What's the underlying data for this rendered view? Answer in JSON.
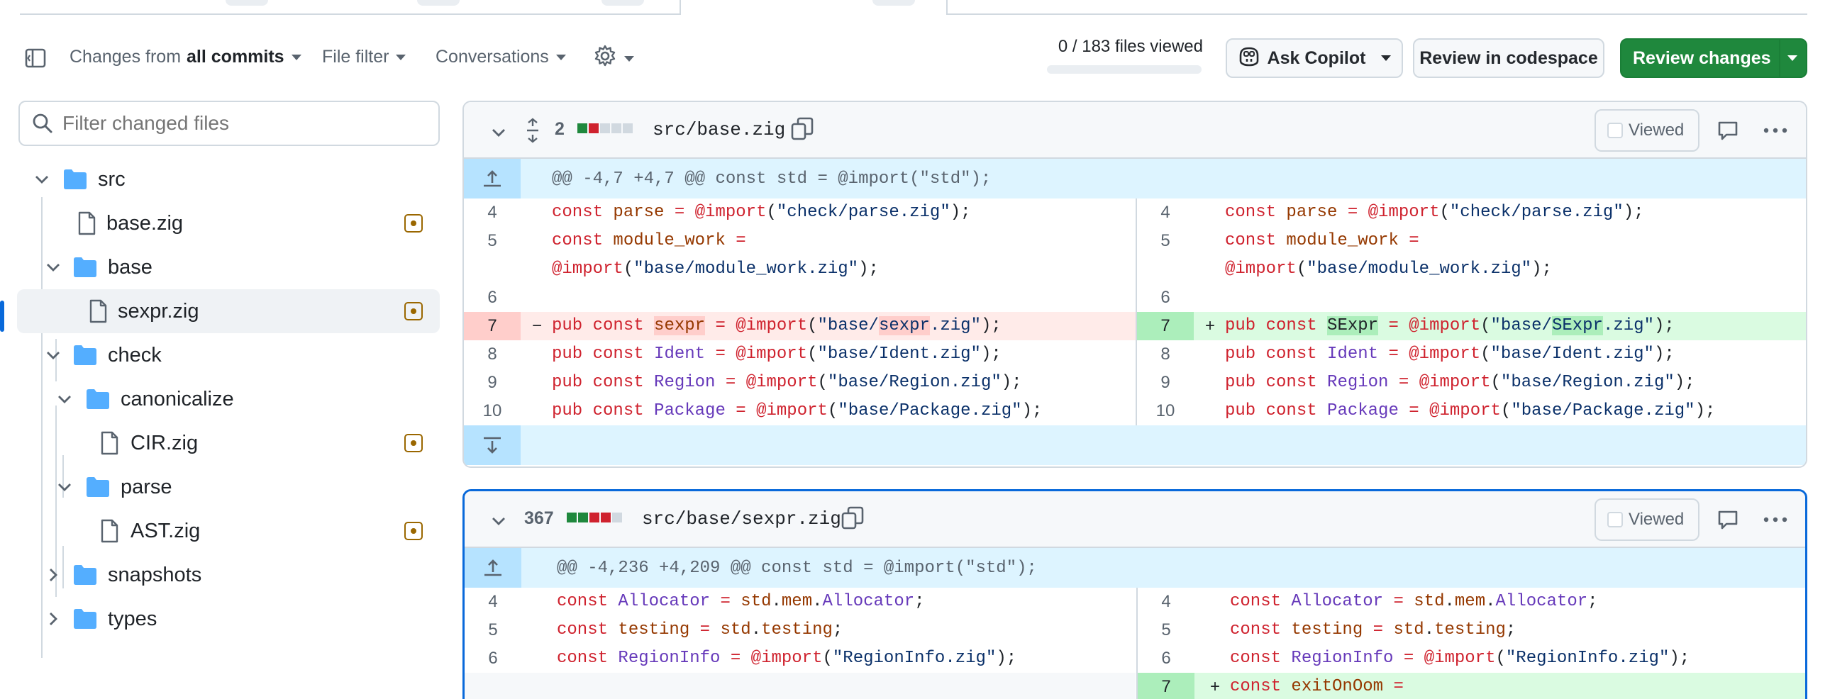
{
  "toolbar": {
    "changes_prefix": "Changes from",
    "changes_value": "all commits",
    "file_filter": "File filter",
    "conversations": "Conversations",
    "files_viewed": "0 / 183 files viewed",
    "files_viewed_progress": 0,
    "ask_copilot": "Ask Copilot",
    "review_codespace": "Review in codespace",
    "review_changes": "Review changes"
  },
  "sidebar": {
    "filter_placeholder": "Filter changed files",
    "tree": [
      {
        "label": "src",
        "type": "folder",
        "expanded": true
      },
      {
        "label": "base.zig",
        "type": "file",
        "status": "modified"
      },
      {
        "label": "base",
        "type": "folder",
        "expanded": true
      },
      {
        "label": "sexpr.zig",
        "type": "file",
        "status": "modified",
        "selected": true
      },
      {
        "label": "check",
        "type": "folder",
        "expanded": true
      },
      {
        "label": "canonicalize",
        "type": "folder",
        "expanded": true
      },
      {
        "label": "CIR.zig",
        "type": "file",
        "status": "modified"
      },
      {
        "label": "parse",
        "type": "folder",
        "expanded": true
      },
      {
        "label": "AST.zig",
        "type": "file",
        "status": "modified"
      },
      {
        "label": "snapshots",
        "type": "folder",
        "expanded": false
      },
      {
        "label": "types",
        "type": "folder",
        "expanded": false
      }
    ]
  },
  "diffs": [
    {
      "changes": "2",
      "filename": "src/base.zig",
      "viewed_label": "Viewed",
      "hunk": "@@ -4,7 +4,7 @@ const std = @import(\"std\");",
      "lines": [
        {
          "left_num": "4",
          "right_num": "4"
        },
        {
          "left_num": "5",
          "right_num": "5"
        },
        {
          "left_num": "",
          "right_num": ""
        },
        {
          "left_num": "6",
          "right_num": "6"
        },
        {
          "left_num": "7",
          "right_num": "7",
          "left_sign": "−",
          "right_sign": "+"
        },
        {
          "left_num": "8",
          "right_num": "8"
        },
        {
          "left_num": "9",
          "right_num": "9"
        },
        {
          "left_num": "10",
          "right_num": "10"
        }
      ]
    },
    {
      "changes": "367",
      "filename": "src/base/sexpr.zig",
      "viewed_label": "Viewed",
      "hunk": "@@ -4,236 +4,209 @@ const std = @import(\"std\");",
      "lines": [
        {
          "left_num": "4",
          "right_num": "4"
        },
        {
          "left_num": "5",
          "right_num": "5"
        },
        {
          "left_num": "6",
          "right_num": "6"
        },
        {
          "left_num": "",
          "right_num": "7",
          "right_sign": "+"
        }
      ]
    }
  ],
  "code": {
    "d1_l4": [
      "const",
      "parse",
      "=",
      "@import",
      "(",
      "\"check/parse.zig\"",
      ");"
    ],
    "d1_l5a": [
      "const",
      "module_work",
      "="
    ],
    "d1_l5b": [
      "@import",
      "(",
      "\"base/module_work.zig\"",
      ");"
    ],
    "d1_del": [
      "pub",
      "const",
      "sexpr",
      "=",
      "@import",
      "(",
      "\"base/",
      "sexpr",
      ".zig\"",
      ");"
    ],
    "d1_add": [
      "pub",
      "const",
      "SExpr",
      "=",
      "@import",
      "(",
      "\"base/",
      "SExpr",
      ".zig\"",
      ");"
    ],
    "d1_l8": [
      "pub",
      "const",
      "Ident",
      "=",
      "@import",
      "(",
      "\"base/Ident.zig\"",
      ");"
    ],
    "d1_l9": [
      "pub",
      "const",
      "Region",
      "=",
      "@import",
      "(",
      "\"base/Region.zig\"",
      ");"
    ],
    "d1_l10": [
      "pub",
      "const",
      "Package",
      "=",
      "@import",
      "(",
      "\"base/Package.zig\"",
      ");"
    ],
    "d2_l4": [
      "const",
      "Allocator",
      "=",
      "std",
      ".",
      "mem",
      ".",
      "Allocator",
      ";"
    ],
    "d2_l5": [
      "const",
      "testing",
      "=",
      "std",
      ".",
      "testing",
      ";"
    ],
    "d2_l6": [
      "const",
      "RegionInfo",
      "=",
      "@import",
      "(",
      "\"RegionInfo.zig\"",
      ");"
    ],
    "d2_l7": [
      "const",
      "exitOnOom",
      "="
    ]
  },
  "colors": {
    "accent_blue": "#0969da",
    "green_button": "#1f883d",
    "deletion_bg": "#ffebe9",
    "addition_bg": "#dafbe1",
    "modified_badge": "#9a6700"
  },
  "icons": [
    "sidebar-toggle-icon",
    "gear-icon",
    "copilot-icon",
    "search-icon",
    "folder-icon",
    "file-icon",
    "chevron-down-icon",
    "chevron-right-icon",
    "expand-icon",
    "copy-icon",
    "comment-icon",
    "kebab-icon",
    "expand-up-icon",
    "expand-down-icon"
  ]
}
